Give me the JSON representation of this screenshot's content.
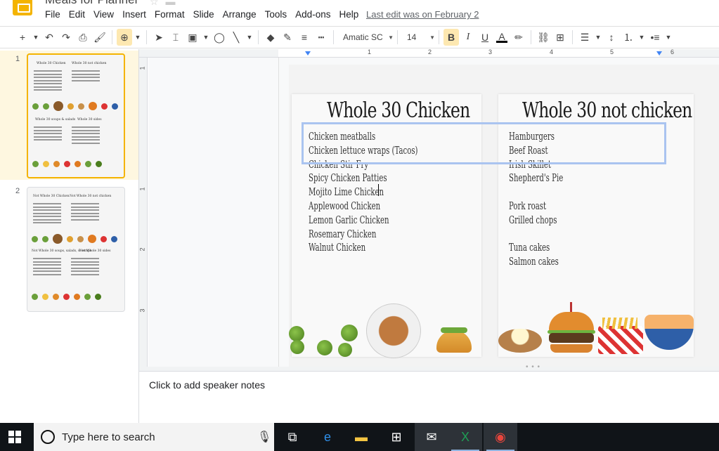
{
  "app": {
    "doc_title": "Meals for Planner",
    "menu": [
      "File",
      "Edit",
      "View",
      "Insert",
      "Format",
      "Slide",
      "Arrange",
      "Tools",
      "Add-ons",
      "Help"
    ],
    "last_edit": "Last edit was on February 2"
  },
  "toolbar": {
    "font": "Amatic SC",
    "font_size": "14",
    "bold_label": "B",
    "italic_label": "I",
    "underline_label": "U",
    "text_color_label": "A"
  },
  "ruler": {
    "h_labels": [
      "1",
      "2",
      "3",
      "4",
      "5",
      "6"
    ],
    "v_labels": [
      "1",
      "1",
      "2",
      "3"
    ]
  },
  "filmstrip": {
    "slides": [
      {
        "number": "1",
        "head_left": "Whole 30 Chicken",
        "head_right": "Whole 30 not chicken",
        "head_left_2": "Whole 30 soups & salads",
        "head_right_2": "Whole 30 sides"
      },
      {
        "number": "2",
        "head_left": "Not Whole 30 Chicken",
        "head_right": "Not Whole 30 not chicken",
        "head_left_2": "Not Whole 30 soups, salads, & wraps",
        "head_right_2": "Not Whole 30 sides"
      }
    ]
  },
  "slide": {
    "left_heading": "Whole 30 Chicken",
    "right_heading": "Whole 30 not chicken",
    "left_items": [
      "Chicken meatballs",
      "Chicken lettuce wraps (Tacos)",
      "Chicken Stir Fry",
      "Spicy Chicken Patties",
      "Mojito Lime Chicken",
      "Applewood Chicken",
      "Lemon Garlic Chicken",
      "Rosemary Chicken",
      "Walnut Chicken"
    ],
    "right_items": [
      "Hamburgers",
      "Beef Roast",
      "Irish Skillet",
      "Shepherd's Pie",
      "",
      "Pork roast",
      "Grilled chops",
      "",
      "Tuna cakes",
      "Salmon cakes"
    ]
  },
  "notes": {
    "placeholder": "Click to add speaker notes"
  },
  "taskbar": {
    "search_placeholder": "Type here to search"
  },
  "colors": {
    "accent": "#f4b400",
    "selection": "#aac4f0",
    "toggle_on": "#fde8b1"
  }
}
